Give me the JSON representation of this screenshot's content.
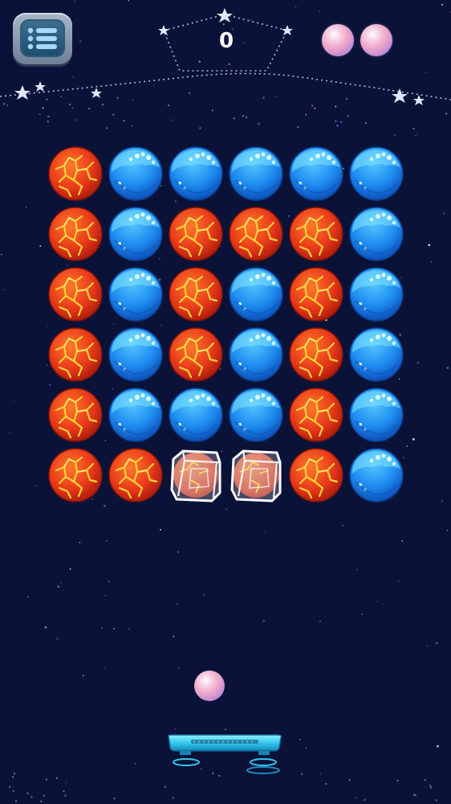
{
  "hud": {
    "score": "0",
    "lives_remaining": 2,
    "menu_icon": "menu-list-icon"
  },
  "board": {
    "rows": 6,
    "columns": 6,
    "cells": [
      [
        "fire",
        "ice",
        "ice",
        "ice",
        "ice",
        "ice"
      ],
      [
        "fire",
        "ice",
        "fire",
        "fire",
        "fire",
        "ice"
      ],
      [
        "fire",
        "ice",
        "fire",
        "ice",
        "fire",
        "ice"
      ],
      [
        "fire",
        "ice",
        "fire",
        "ice",
        "fire",
        "ice"
      ],
      [
        "fire",
        "ice",
        "ice",
        "ice",
        "fire",
        "ice"
      ],
      [
        "fire",
        "fire",
        "fire-frozen",
        "fire-frozen",
        "fire",
        "ice"
      ]
    ]
  },
  "colors": {
    "background": "#0a1238",
    "fire": "#e8391a",
    "ice": "#1d8cf0",
    "paddle": "#35c8ee"
  },
  "objects": {
    "ball_icon": "ball-icon",
    "paddle_icon": "paddle-icon"
  }
}
